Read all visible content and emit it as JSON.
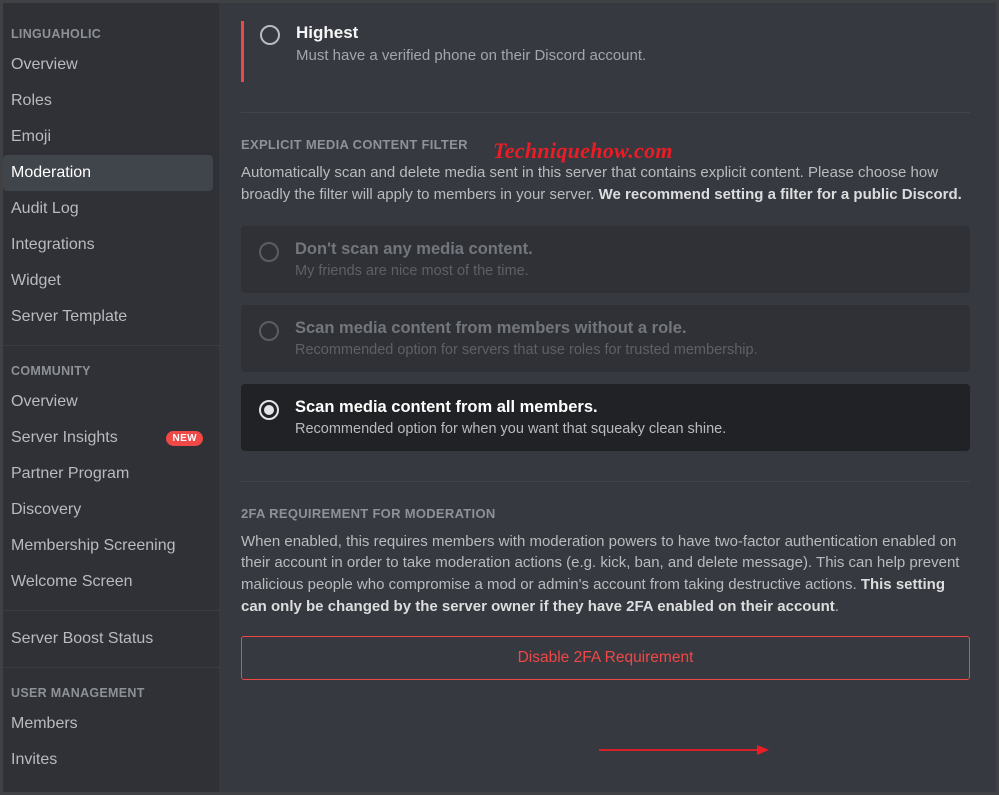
{
  "watermark": "Techniquehow.com",
  "sidebar": {
    "linguaholic_heading": "LINGUAHOLIC",
    "community_heading": "COMMUNITY",
    "user_management_heading": "USER MANAGEMENT",
    "items": {
      "overview": "Overview",
      "roles": "Roles",
      "emoji": "Emoji",
      "moderation": "Moderation",
      "audit_log": "Audit Log",
      "integrations": "Integrations",
      "widget": "Widget",
      "server_template": "Server Template",
      "overview2": "Overview",
      "server_insights": "Server Insights",
      "new_badge": "NEW",
      "partner_program": "Partner Program",
      "discovery": "Discovery",
      "membership_screening": "Membership Screening",
      "welcome_screen": "Welcome Screen",
      "server_boost": "Server Boost Status",
      "members": "Members",
      "invites": "Invites"
    }
  },
  "verification": {
    "highest_title": "Highest",
    "highest_desc": "Must have a verified phone on their Discord account."
  },
  "explicit": {
    "heading": "EXPLICIT MEDIA CONTENT FILTER",
    "desc_pre": "Automatically scan and delete media sent in this server that contains explicit content. Please choose how broadly the filter will apply to members in your server. ",
    "desc_bold": "We recommend setting a filter for a public Discord.",
    "opt1_title": "Don't scan any media content.",
    "opt1_sub": "My friends are nice most of the time.",
    "opt2_title": "Scan media content from members without a role.",
    "opt2_sub": "Recommended option for servers that use roles for trusted membership.",
    "opt3_title": "Scan media content from all members.",
    "opt3_sub": "Recommended option for when you want that squeaky clean shine."
  },
  "twofa": {
    "heading": "2FA REQUIREMENT FOR MODERATION",
    "desc_pre": "When enabled, this requires members with moderation powers to have two-factor authentication enabled on their account in order to take moderation actions (e.g. kick, ban, and delete message). This can help prevent malicious people who compromise a mod or admin's account from taking destructive actions. ",
    "desc_bold": "This setting can only be changed by the server owner if they have 2FA enabled on their account",
    "desc_post": ".",
    "button": "Disable 2FA Requirement"
  }
}
